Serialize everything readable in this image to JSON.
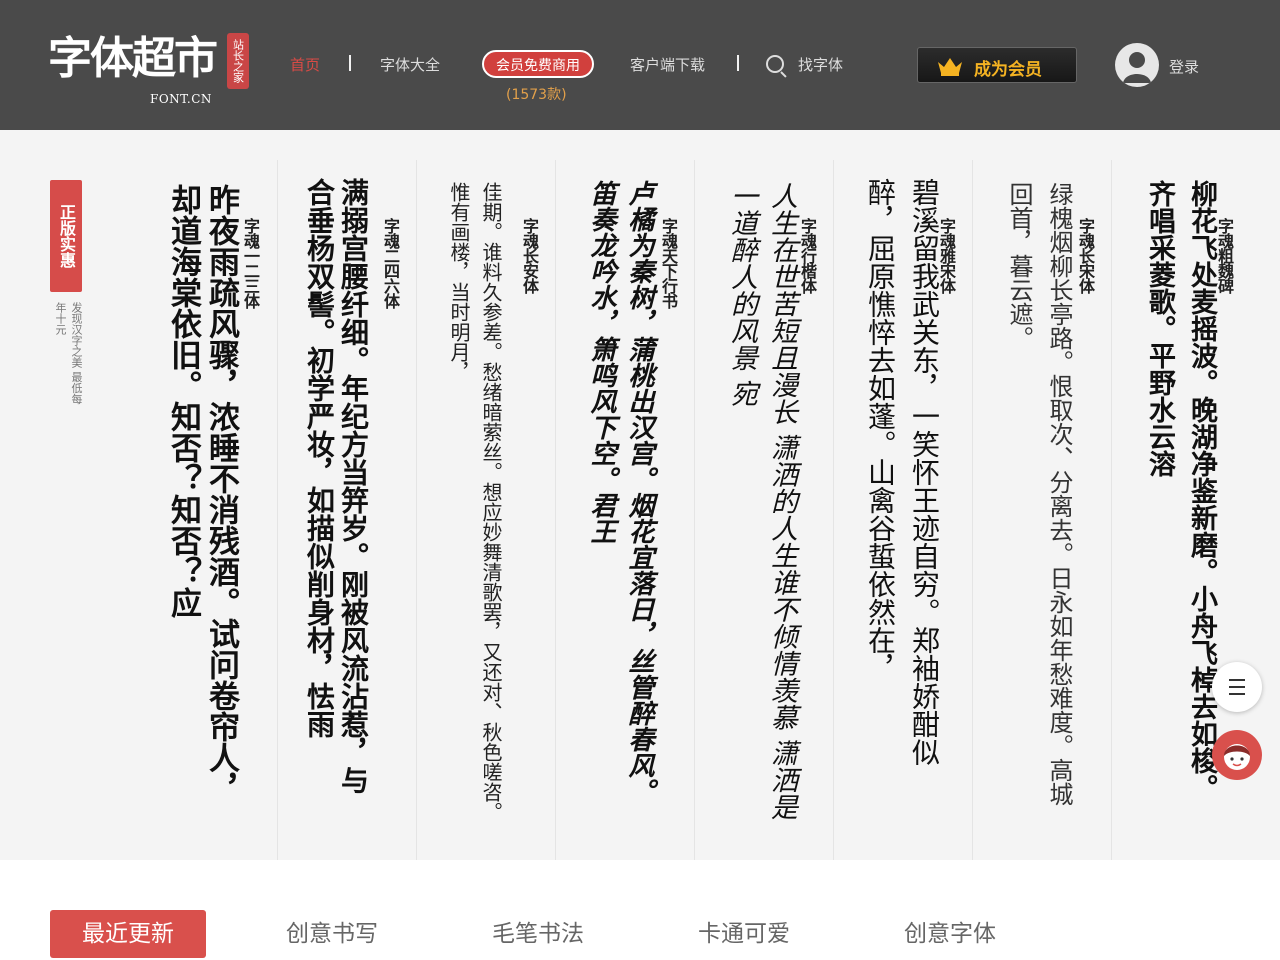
{
  "header": {
    "logo_title": "字体超市",
    "logo_stamp": "站长之家",
    "logo_domain": "FONT.CN",
    "nav": [
      {
        "label": "首页",
        "active": true
      },
      {
        "label": "字体大全",
        "active": false
      },
      {
        "label": "客户端下载",
        "active": false
      }
    ],
    "vip_free": {
      "label": "会员免费商用",
      "count": "(1573款)"
    },
    "search_label": "找字体",
    "member_button": "成为会员",
    "login_label": "登录",
    "colors": {
      "bg": "#4a4a4a",
      "accent": "#d1403d",
      "gold": "#f5b322"
    }
  },
  "promo": {
    "tag": "正版实惠",
    "desc": "发现汉字之美 最低每年十元"
  },
  "fonts": [
    {
      "name": "字魂一二三体",
      "text": "昨夜雨疏风骤，浓睡不消残酒。试问卷帘人，却道海棠依旧。知否？知否？应"
    },
    {
      "name": "字魂二四六体",
      "text": "满搦宫腰纤细。年纪方当笄岁。刚被风流沾惹，与合垂杨双髻。初学严妆，如描似削身材，怯雨"
    },
    {
      "name": "字魂长安体",
      "text": "佳期。谁料久参差。愁绪暗萦丝。想应妙舞清歌罢，又还对、秋色嗟咨。惟有画楼，当时明月，"
    },
    {
      "name": "字魂天下行书",
      "text": "卢橘为秦树，蒲桃出汉宫。烟花宜落日，丝管醉春风。笛奏龙吟水，箫鸣风下空。君王"
    },
    {
      "name": "字魂行楷体",
      "text": "人生在世苦短且漫长 潇洒的人生谁不倾情羡慕 潇洒是一道醉人的风景 宛"
    },
    {
      "name": "字魂雅宋体",
      "text": "碧溪留我武关东，一笑怀王迹自穷。郑袖娇酣似醉，屈原憔悴去如蓬。山禽谷蜇依然在，"
    },
    {
      "name": "字魂长宋体",
      "text": "绿槐烟柳长亭路。恨取次、分离去。日永如年愁难度。高城回首，暮云遮。"
    },
    {
      "name": "字魂粗魏碑",
      "text": "柳花飞处麦摇波。晚湖净鉴新磨。小舟飞棹去如梭。齐唱采菱歌。平野水云溶"
    }
  ],
  "tabs": [
    "最近更新",
    "创意书写",
    "毛笔书法",
    "卡通可爱",
    "创意字体"
  ],
  "colors": {
    "tab_active": "#d9504c",
    "showcase_bg": "#f4f4f4"
  }
}
